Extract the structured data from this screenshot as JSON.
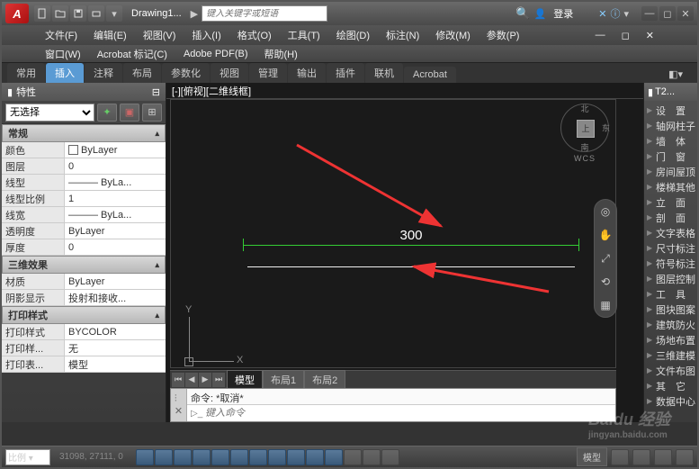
{
  "titlebar": {
    "logo": "A",
    "doc_name": "Drawing1...",
    "search_placeholder": "键入关键字或短语",
    "login": "登录"
  },
  "menu1": [
    "文件(F)",
    "编辑(E)",
    "视图(V)",
    "插入(I)",
    "格式(O)",
    "工具(T)",
    "绘图(D)",
    "标注(N)",
    "修改(M)",
    "参数(P)"
  ],
  "menu2": [
    "窗口(W)",
    "Acrobat 标记(C)",
    "Adobe PDF(B)",
    "帮助(H)"
  ],
  "ribbon": {
    "tabs": [
      "常用",
      "插入",
      "注释",
      "布局",
      "参数化",
      "视图",
      "管理",
      "输出",
      "插件",
      "联机",
      "Acrobat"
    ],
    "active": 1
  },
  "props": {
    "title": "特性",
    "right_title": "T2...",
    "selector": "无选择",
    "groups": [
      {
        "name": "常规",
        "rows": [
          {
            "k": "颜色",
            "v": "ByLayer",
            "swatch": true
          },
          {
            "k": "图层",
            "v": "0"
          },
          {
            "k": "线型",
            "v": "——— ByLa..."
          },
          {
            "k": "线型比例",
            "v": "1"
          },
          {
            "k": "线宽",
            "v": "——— ByLa..."
          },
          {
            "k": "透明度",
            "v": "ByLayer"
          },
          {
            "k": "厚度",
            "v": "0"
          }
        ]
      },
      {
        "name": "三维效果",
        "rows": [
          {
            "k": "材质",
            "v": "ByLayer"
          },
          {
            "k": "阴影显示",
            "v": "投射和接收..."
          }
        ]
      },
      {
        "name": "打印样式",
        "rows": [
          {
            "k": "打印样式",
            "v": "BYCOLOR"
          },
          {
            "k": "打印样...",
            "v": "无"
          },
          {
            "k": "打印表...",
            "v": "模型"
          }
        ]
      }
    ]
  },
  "viewport": {
    "label": "[-][俯视][二维线框]",
    "compass": {
      "n": "北",
      "e": "东",
      "s": "南",
      "face": "上",
      "wcs": "WCS"
    },
    "ucs": {
      "x": "X",
      "y": "Y"
    },
    "dimension": "300"
  },
  "layout_tabs": [
    "模型",
    "布局1",
    "布局2"
  ],
  "cmd": {
    "history": "命令: *取消*",
    "placeholder": "键入命令",
    "prompt": "▷_"
  },
  "right_items": [
    "设　置",
    "轴网柱子",
    "墙　体",
    "门　窗",
    "房间屋顶",
    "楼梯其他",
    "立　面",
    "剖　面",
    "文字表格",
    "尺寸标注",
    "符号标注",
    "图层控制",
    "工　具",
    "图块图案",
    "建筑防火",
    "场地布置",
    "三维建模",
    "文件布图",
    "其　它",
    "数据中心"
  ],
  "status": {
    "scale": "比例 ▾",
    "coords": "31098, 27111, 0",
    "model": "模型"
  },
  "watermark": {
    "brand": "Baidu 经验",
    "url": "jingyan.baidu.com"
  }
}
